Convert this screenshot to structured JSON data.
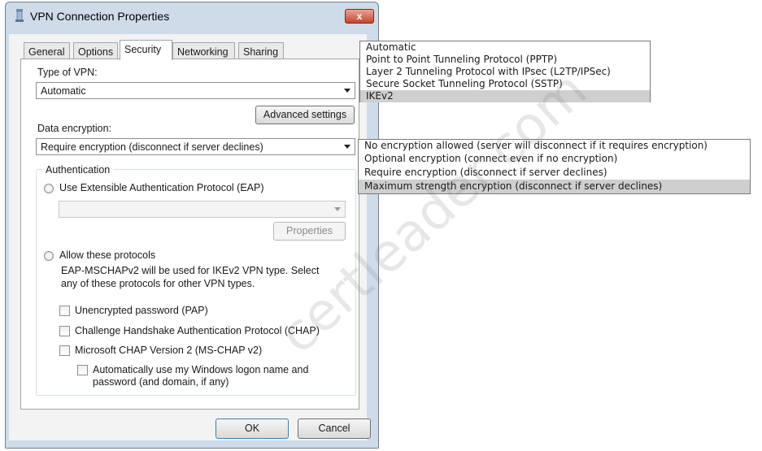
{
  "window": {
    "title": "VPN Connection Properties",
    "close_glyph": "x"
  },
  "tabs": [
    {
      "label": "General"
    },
    {
      "label": "Options"
    },
    {
      "label": "Security"
    },
    {
      "label": "Networking"
    },
    {
      "label": "Sharing"
    }
  ],
  "security": {
    "vpn_type_label": "Type of VPN:",
    "vpn_type_value": "Automatic",
    "advanced_settings": "Advanced settings",
    "data_encryption_label": "Data encryption:",
    "data_encryption_value": "Require encryption (disconnect if server declines)",
    "authentication": {
      "group_label": "Authentication",
      "eap_radio_label": "Use Extensible Authentication Protocol (EAP)",
      "eap_combo_value": "",
      "properties_button": "Properties",
      "allow_radio_label": "Allow these protocols",
      "allow_note_line1": "EAP-MSCHAPv2 will be used for IKEv2 VPN type. Select",
      "allow_note_line2": "any of these protocols for other VPN types.",
      "protocols": [
        {
          "label": "Unencrypted password (PAP)"
        },
        {
          "label": "Challenge Handshake Authentication Protocol (CHAP)"
        },
        {
          "label": "Microsoft CHAP Version 2 (MS-CHAP v2)"
        }
      ],
      "auto_logon_line1": "Automatically use my Windows logon name and",
      "auto_logon_line2": "password (and domain, if any)"
    }
  },
  "buttons": {
    "ok": "OK",
    "cancel": "Cancel"
  },
  "vpn_type_options": [
    "Automatic",
    "Point to Point Tunneling Protocol (PPTP)",
    "Layer 2 Tunneling Protocol with IPsec (L2TP/IPSec)",
    "Secure Socket Tunneling Protocol (SSTP)",
    "IKEv2"
  ],
  "vpn_type_selected_index": 4,
  "encryption_options": [
    "No encryption allowed (server will disconnect if it requires encryption)",
    "Optional encryption (connect even if no encryption)",
    "Require encryption (disconnect if server declines)",
    "Maximum strength encryption (disconnect if server declines)"
  ],
  "encryption_selected_index": 3,
  "watermark": "certleader.com"
}
